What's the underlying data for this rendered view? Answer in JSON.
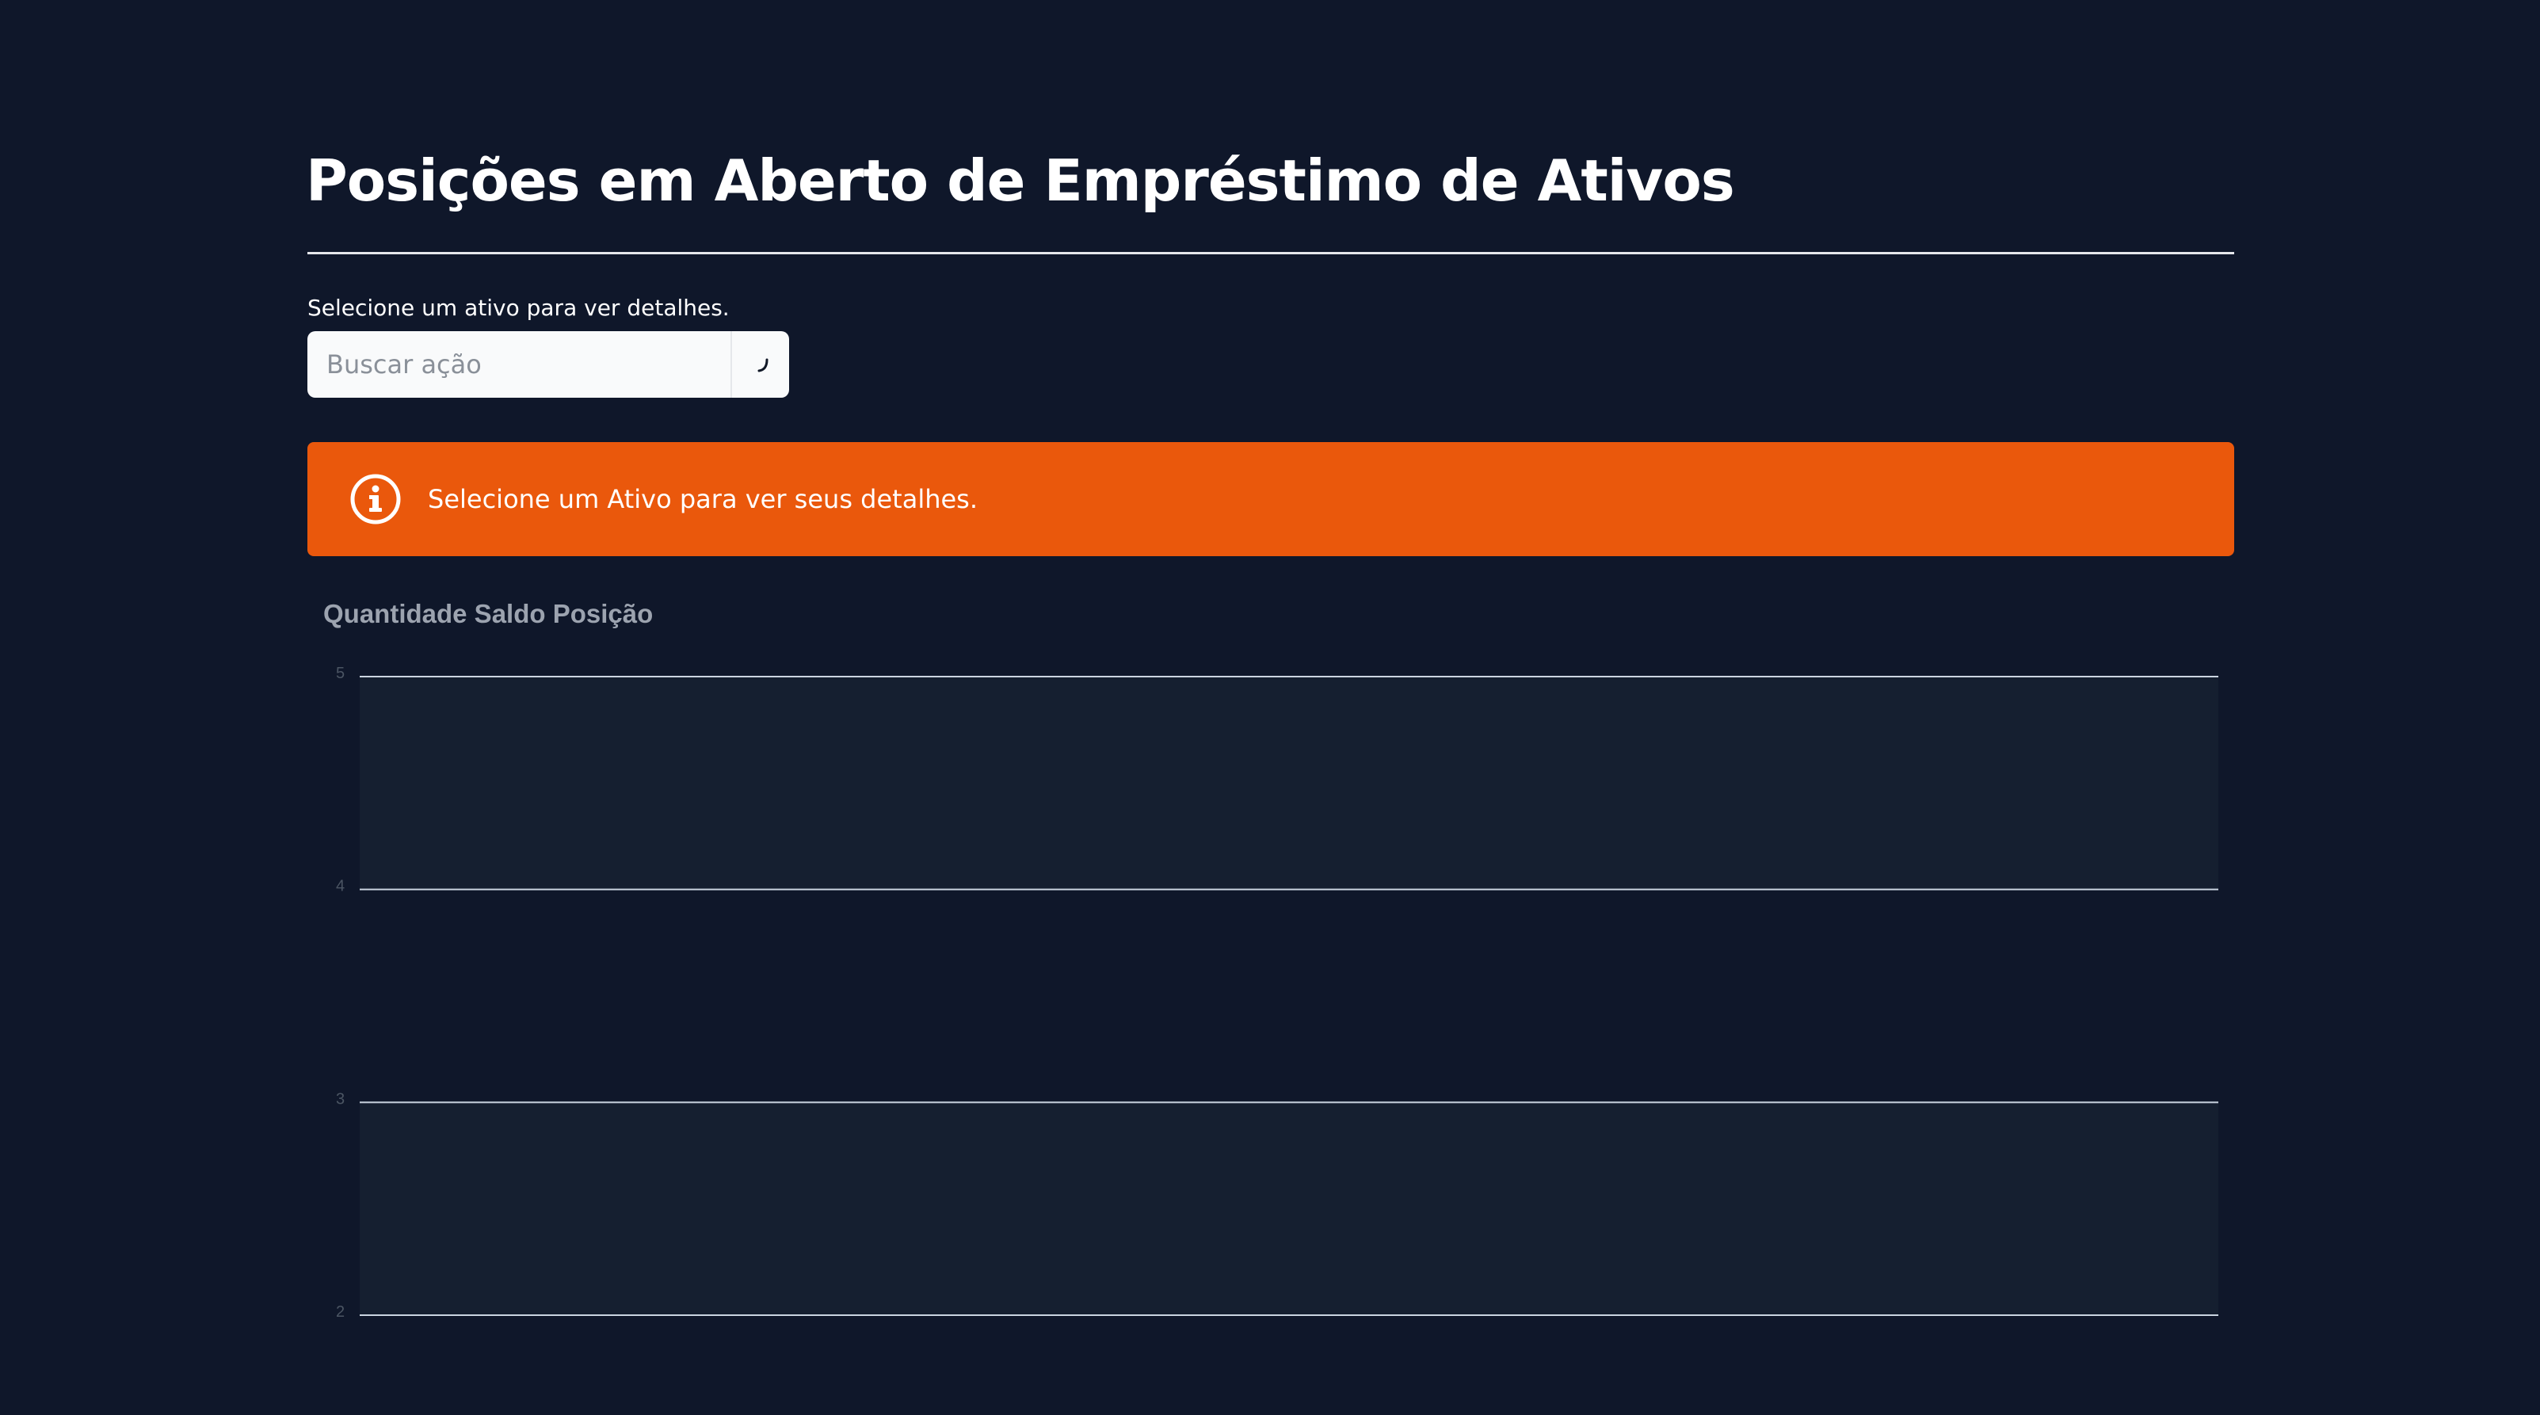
{
  "page": {
    "title": "Posições em Aberto de Empréstimo de Ativos",
    "select_label": "Selecione um ativo para ver detalhes."
  },
  "search": {
    "placeholder": "Buscar ação",
    "value": "",
    "button_icon": "search-icon"
  },
  "alert": {
    "icon": "info-icon",
    "text": "Selecione um Ativo para ver seus detalhes.",
    "color": "#ea580c"
  },
  "colors": {
    "background": "#0f172a",
    "band": "#151f30",
    "gridline": "#cbd5e1",
    "accent": "#ea580c"
  },
  "chart_data": {
    "type": "line",
    "title": "Quantidade Saldo Posição",
    "xlabel": "",
    "ylabel": "",
    "ylim": [
      2,
      5
    ],
    "y_ticks": [
      5,
      4,
      3,
      2
    ],
    "grid": true,
    "series": []
  }
}
